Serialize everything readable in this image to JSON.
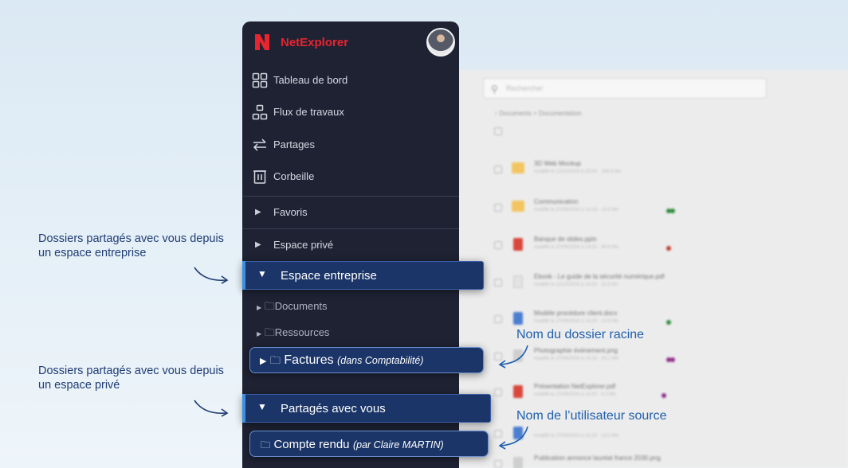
{
  "app": {
    "name": "NetExplorer",
    "brand_color": "#e8242f",
    "sidebar_bg": "#1e2233",
    "highlight_bg": "#1b3568",
    "accent": "#3d8fe0"
  },
  "nav": [
    {
      "label": "Tableau de bord",
      "icon": "dashboard-grid-icon"
    },
    {
      "label": "Flux de travaux",
      "icon": "workflow-icon"
    },
    {
      "label": "Partages",
      "icon": "share-arrows-icon"
    },
    {
      "label": "Corbeille",
      "icon": "trash-icon"
    }
  ],
  "sections": {
    "favoris": "Favoris",
    "espace_prive": "Espace privé",
    "espace_entreprise": "Espace entreprise",
    "partages_avec_vous": "Partagés avec vous"
  },
  "entreprise_items": [
    {
      "label": "Documents"
    },
    {
      "label": "Ressources"
    }
  ],
  "factures": {
    "name": "Factures",
    "note": "(dans Comptabilité)"
  },
  "compte_rendu": {
    "name": "Compte rendu",
    "note": "(par Claire MARTIN)"
  },
  "annotations": {
    "entreprise": "Dossiers partagés avec vous depuis un espace entreprise",
    "prive": "Dossiers partagés avec vous depuis un espace privé",
    "racine": "Nom du dossier racine",
    "utilisateur": "Nom de l’utilisateur source"
  },
  "background": {
    "search_placeholder": "Rechercher",
    "breadcrumb": "Documents > Documentation",
    "files": [
      {
        "name": "3D Web Mockup",
        "meta": "modifié le 12/10/2024 à 15:54 · 164.8 Mo",
        "kind": "folder",
        "tag_colors": []
      },
      {
        "name": "Communication",
        "meta": "modifié le 27/09/2024 à 14:18 · 13.5 Mo",
        "kind": "folder",
        "tag_colors": [
          "#2e8b3c",
          "#2e8b3c"
        ]
      },
      {
        "name": "Banque de slides.pptx",
        "meta": "modifié le 27/09/2024 à 14:32 · 90.8 Mo",
        "kind": "pdf",
        "tag_colors": [
          "#c0392b"
        ]
      },
      {
        "name": "Ebook - Le guide de la sécurité numérique.pdf",
        "meta": "modifié le 12/10/2024 à 14:03 · 11.9 Mo",
        "kind": "doc",
        "tag_colors": []
      },
      {
        "name": "Modèle procédure client.docx",
        "meta": "modifié le 27/09/2024 à 14:19 · 13.5 Mo",
        "kind": "word",
        "tag_colors": [
          "#2e8b3c"
        ]
      },
      {
        "name": "Photographie événement.png",
        "meta": "modifié le 27/09/2024 à 14:20 · 20.1 Mo",
        "kind": "image",
        "tag_colors": [
          "#8e2e8a",
          "#8e2e8a"
        ]
      },
      {
        "name": "Présentation NetExplorer.pdf",
        "meta": "modifié le 27/09/2024 à 14:20 · 6.3 Mo",
        "kind": "pdf",
        "tag_colors": [
          "#8e2e8a"
        ]
      },
      {
        "name": "",
        "meta": "modifié le 27/09/2024 à 14:20 · 13.5 Mo",
        "kind": "word",
        "tag_colors": []
      },
      {
        "name": "Publication annonce lauréat france 2030.png",
        "meta": "",
        "kind": "image",
        "tag_colors": []
      }
    ]
  }
}
